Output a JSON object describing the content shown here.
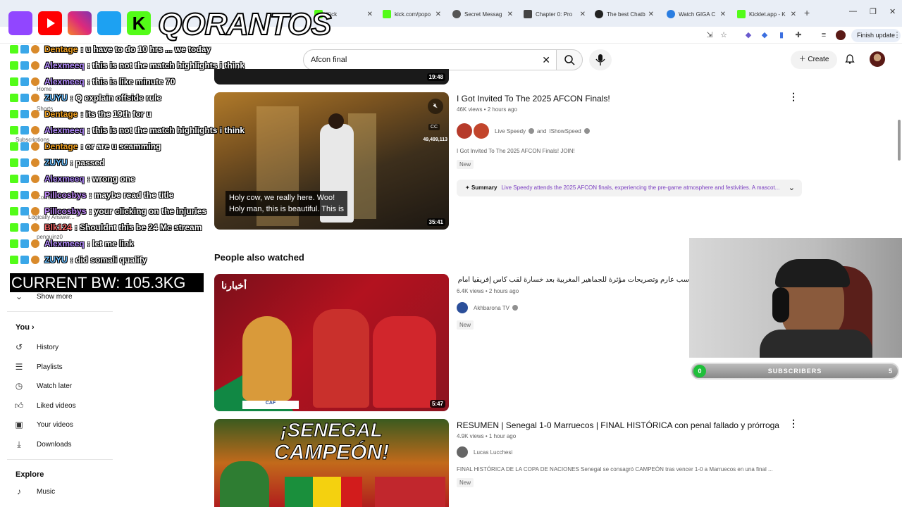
{
  "browser": {
    "tabs": [
      {
        "label": "Kick",
        "color": "#53fc18"
      },
      {
        "label": "kick.com/popo",
        "color": "#53fc18"
      },
      {
        "label": "Secret Messag",
        "color": "#555555"
      },
      {
        "label": "Chapter 0: Pro",
        "color": "#444444"
      },
      {
        "label": "The best Chatb",
        "color": "#222222"
      },
      {
        "label": "Watch GIGA C",
        "color": "#2a7de1"
      },
      {
        "label": "Kicklet.app - K",
        "color": "#53fc18"
      }
    ],
    "new_tab": "+",
    "finish_update": "Finish update"
  },
  "search": {
    "query": "Afcon final",
    "clear": "✕"
  },
  "header": {
    "create_label": "Create"
  },
  "sidebar": {
    "home": "Home",
    "shorts": "Shorts",
    "subscriptions": "Subscriptions",
    "subs_faint": [
      "Correezilla",
      "Logically Answer...",
      "penguinz0"
    ],
    "show_more": "Show more",
    "you": "You",
    "you_items": [
      {
        "label": "History",
        "icon": "history-icon"
      },
      {
        "label": "Playlists",
        "icon": "playlists-icon"
      },
      {
        "label": "Watch later",
        "icon": "watch-later-icon"
      },
      {
        "label": "Liked videos",
        "icon": "liked-videos-icon"
      },
      {
        "label": "Your videos",
        "icon": "your-videos-icon"
      },
      {
        "label": "Downloads",
        "icon": "downloads-icon"
      }
    ],
    "explore": "Explore",
    "explore_items": [
      {
        "label": "Music",
        "icon": "music-icon"
      }
    ]
  },
  "overlay": {
    "brand": "QORANTOS",
    "current_bw": "CURRENT BW: 105.3KG",
    "chat": [
      {
        "user": "Dentage",
        "color": "#f0a020",
        "text": ": u have to do 10 hrs ... we today"
      },
      {
        "user": "Alexmeeq",
        "color": "#b48cff",
        "text": ": this is not the match highlights i think"
      },
      {
        "user": "Alexmeeq",
        "color": "#b48cff",
        "text": ": this is like minute 70"
      },
      {
        "user": "ZUYU",
        "color": "#6ec1ff",
        "text": ": Q explain offside rule"
      },
      {
        "user": "Dentage",
        "color": "#f0a020",
        "text": ": its the 19th for u"
      },
      {
        "user": "Alexmeeq",
        "color": "#b48cff",
        "text": ": this is not the match highlights i think"
      },
      {
        "user": "Dentage",
        "color": "#f0a020",
        "text": ": or are u scamming"
      },
      {
        "user": "ZUYU",
        "color": "#6ec1ff",
        "text": ": passed"
      },
      {
        "user": "Alexmeeq",
        "color": "#b48cff",
        "text": ": wrong one"
      },
      {
        "user": "Pillcosbys",
        "color": "#c58cff",
        "text": ": maybe read the title"
      },
      {
        "user": "Pillcosbys",
        "color": "#c58cff",
        "text": ": your clicking on the injuries"
      },
      {
        "user": "Blk124",
        "color": "#ff6a6a",
        "text": ": Shouldnt this be 24 Mc stream"
      },
      {
        "user": "Alexmeeq",
        "color": "#b48cff",
        "text": ": let me link"
      },
      {
        "user": "ZUYU",
        "color": "#6ec1ff",
        "text": ": did somali qualify"
      }
    ]
  },
  "results": {
    "top_duration": "19:48",
    "video1": {
      "title": "I Got Invited To The 2025 AFCON Finals!",
      "meta": "46K views • 2 hours ago",
      "channel": "Live Speedy",
      "channel_and": "and",
      "channel2": "IShowSpeed",
      "desc": "I Got Invited To The 2025 AFCON Finals! JOIN!",
      "badge": "New",
      "duration": "35:41",
      "caption1": "Holy cow, we really here. Woo!",
      "caption2": "Holy man, this is beautiful. This is",
      "cc": "CC",
      "counter": "49,499,113",
      "summary_label": "Summary",
      "summary": "Live Speedy attends the 2025 AFCON finals, experiencing the pre-game atmosphere and festivities. A mascot..."
    },
    "section_title": "People also watched",
    "video2": {
      "title": "سب عارم وتصريحات مؤثرة للجماهير المغربية بعد خسارة لقب كأس إفريقيا أمام السنغال",
      "meta": "6.4K views • 2 hours ago",
      "channel": "Akhbarona TV",
      "badge": "New",
      "duration": "5:47",
      "thumb_text": "أخبارنا"
    },
    "video3": {
      "title": "RESUMEN | Senegal 1-0 Marruecos | FINAL HISTÓRICA con penal fallado y prórroga",
      "meta": "4.9K views • 1 hour ago",
      "channel": "Lucas Lucchesi",
      "desc": "FINAL HISTÓRICA DE LA COPA DE NACIONES Senegal se consagró CAMPEÓN tras vencer 1-0 a Marruecos en una final ...",
      "badge": "New",
      "thumb_line1": "¡SENEGAL",
      "thumb_line2": "CAMPEÓN!"
    }
  },
  "webcam": {
    "sub_left": "0",
    "sub_label": "SUBSCRIBERS",
    "sub_right": "5"
  },
  "colors": {
    "kick_green": "#53fc18",
    "youtube_red": "#ff0000"
  }
}
